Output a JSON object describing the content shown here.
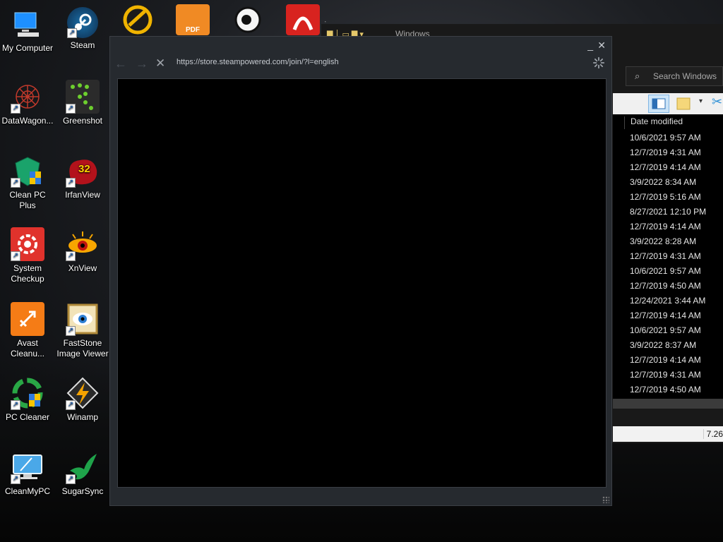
{
  "desktop": {
    "icons": [
      {
        "label": "My Computer",
        "icon": "computer-icon"
      },
      {
        "label": "Steam",
        "icon": "steam-icon"
      },
      {
        "label": "DataWagon...",
        "icon": "datawagon-icon"
      },
      {
        "label": "Greenshot",
        "icon": "greenshot-icon"
      },
      {
        "label": "Clean PC Plus",
        "icon": "clean-pc-plus-icon"
      },
      {
        "label": "IrfanView",
        "icon": "irfanview-icon"
      },
      {
        "label": "System Checkup",
        "icon": "system-checkup-icon"
      },
      {
        "label": "XnView",
        "icon": "xnview-icon"
      },
      {
        "label": "Avast Cleanu...",
        "icon": "avast-icon"
      },
      {
        "label": "FastStone Image Viewer",
        "icon": "faststone-icon"
      },
      {
        "label": "PC Cleaner",
        "icon": "pc-cleaner-icon"
      },
      {
        "label": "Winamp",
        "icon": "winamp-icon"
      },
      {
        "label": "CleanMyPC",
        "icon": "cleanmypc-icon"
      },
      {
        "label": "SugarSync",
        "icon": "sugarsync-icon"
      }
    ],
    "irfanview_badge": "32",
    "top_icon_pdf_text": "PDF"
  },
  "explorer": {
    "title": "Windows",
    "search_placeholder": "Search Windows",
    "column_header": "Date modified",
    "dates": [
      "10/6/2021 9:57 AM",
      "12/7/2019 4:31 AM",
      "12/7/2019 4:14 AM",
      "3/9/2022 8:34 AM",
      "12/7/2019 5:16 AM",
      "8/27/2021 12:10 PM",
      "12/7/2019 4:14 AM",
      "3/9/2022 8:28 AM",
      "12/7/2019 4:31 AM",
      "10/6/2021 9:57 AM",
      "12/7/2019 4:50 AM",
      "12/24/2021 3:44 AM",
      "12/7/2019 4:14 AM",
      "10/6/2021 9:57 AM",
      "3/9/2022 8:37 AM",
      "12/7/2019 4:14 AM",
      "12/7/2019 4:31 AM",
      "12/7/2019 4:50 AM"
    ],
    "status_size": "7.26"
  },
  "steam_popup": {
    "url": "https://store.steampowered.com/join/?l=english",
    "minimize": "_",
    "close": "✕"
  }
}
